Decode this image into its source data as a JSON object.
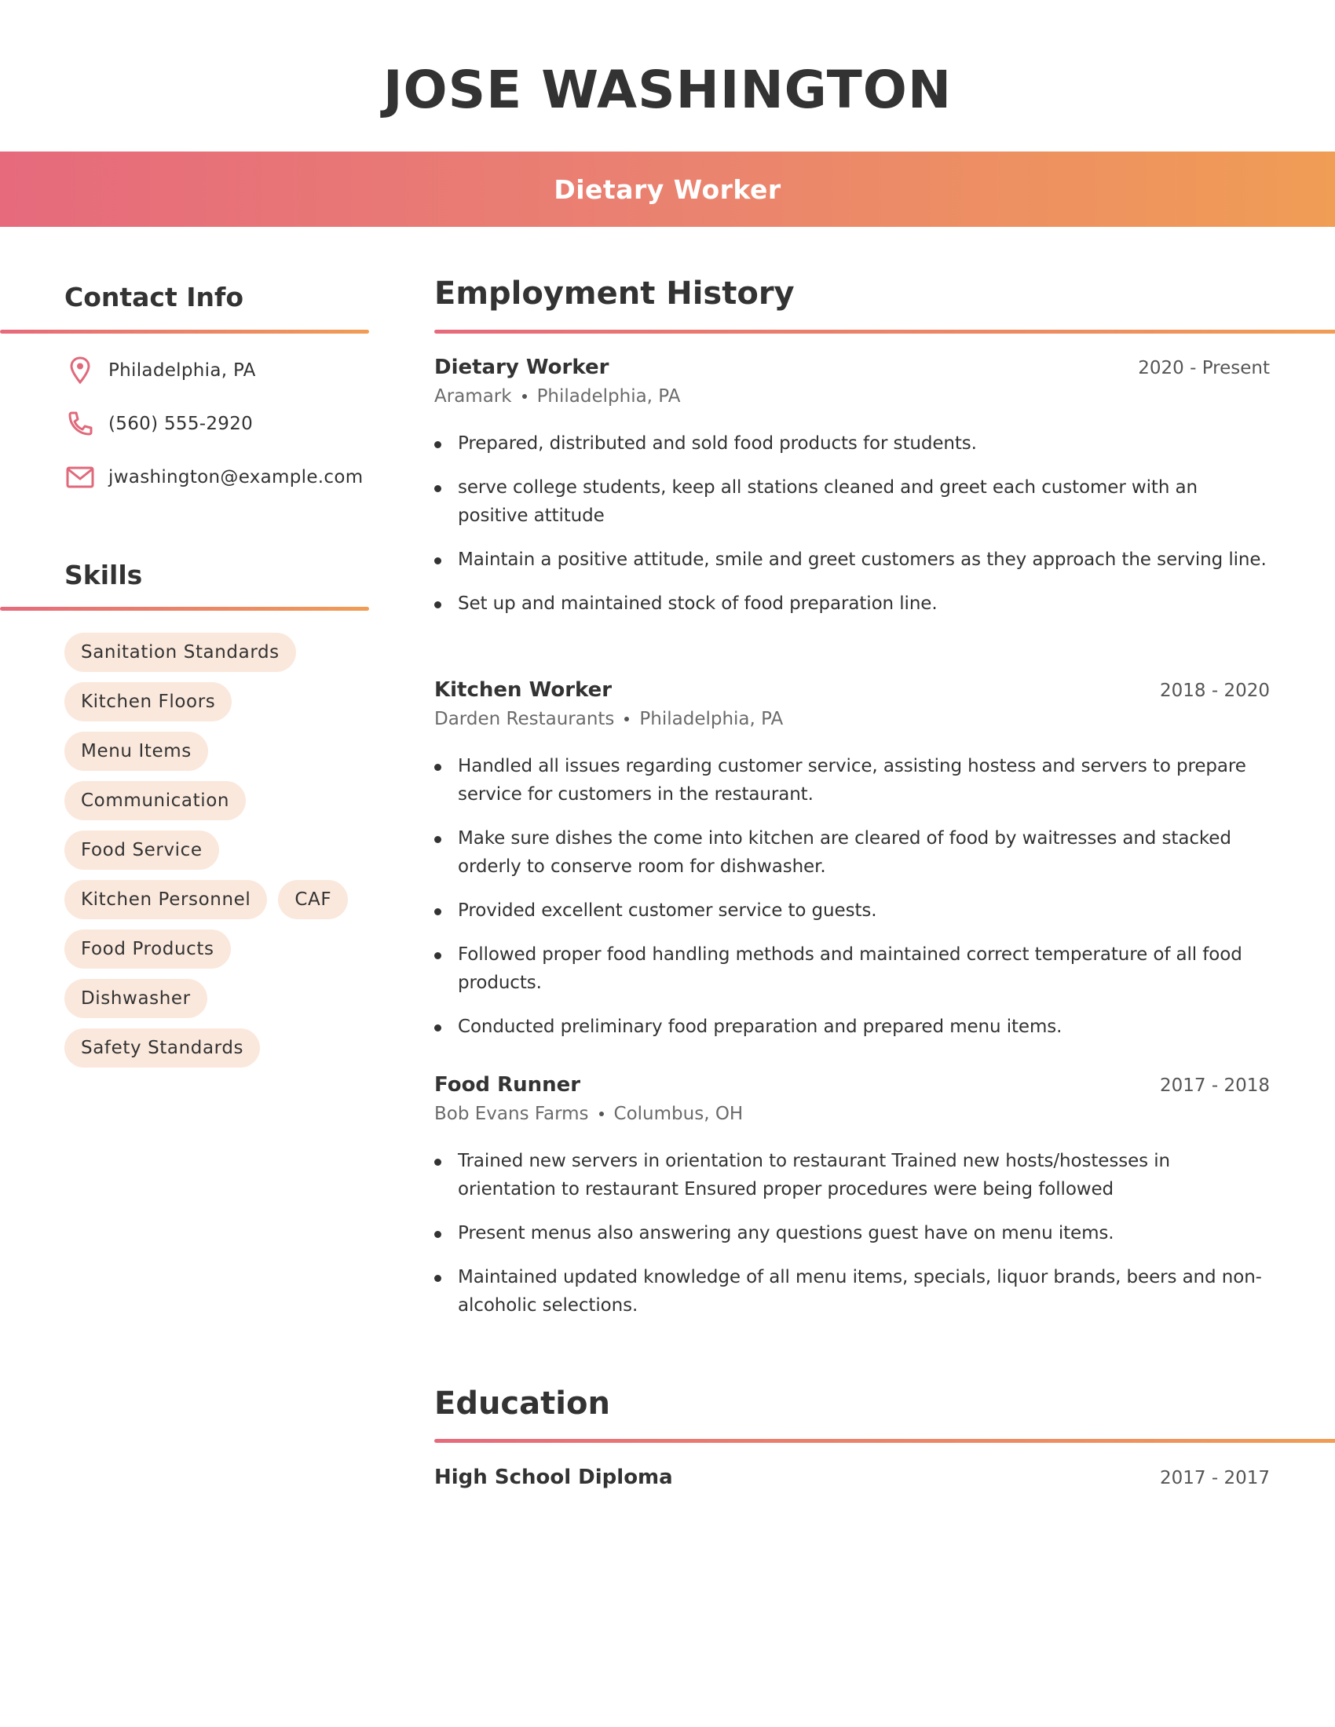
{
  "header": {
    "name": "JOSE WASHINGTON",
    "title": "Dietary Worker"
  },
  "colors": {
    "gradient_start": "#e66a7c",
    "gradient_end": "#f09d55",
    "pill_background": "#fbe8dc",
    "text_primary": "#333333",
    "icon": "#e0697b"
  },
  "contact": {
    "heading": "Contact Info",
    "items": [
      {
        "icon": "location-pin-icon",
        "text": "Philadelphia, PA"
      },
      {
        "icon": "phone-icon",
        "text": "(560) 555-2920"
      },
      {
        "icon": "mail-icon",
        "text": "jwashington@example.com"
      }
    ]
  },
  "skills": {
    "heading": "Skills",
    "rows": [
      [
        "Sanitation Standards"
      ],
      [
        "Kitchen Floors"
      ],
      [
        "Menu Items"
      ],
      [
        "Communication"
      ],
      [
        "Food Service"
      ],
      [
        "Kitchen Personnel",
        "CAF"
      ],
      [
        "Food Products"
      ],
      [
        "Dishwasher"
      ],
      [
        "Safety Standards"
      ]
    ]
  },
  "employment": {
    "heading": "Employment History",
    "jobs": [
      {
        "title": "Dietary Worker",
        "dates": "2020 - Present",
        "company": "Aramark",
        "location": "Philadelphia, PA",
        "bullets": [
          "Prepared, distributed and sold food products for students.",
          "serve college students, keep all stations cleaned and greet each customer with an positive attitude",
          "Maintain a positive attitude, smile and greet customers as they approach the serving line.",
          "Set up and maintained stock of food preparation line."
        ]
      },
      {
        "title": "Kitchen Worker",
        "dates": "2018 - 2020",
        "company": "Darden Restaurants",
        "location": "Philadelphia, PA",
        "bullets": [
          "Handled all issues regarding customer service, assisting hostess and servers to prepare service for customers in the restaurant.",
          "Make sure dishes the come into kitchen are cleared of food by waitresses and stacked orderly to conserve room for dishwasher.",
          "Provided excellent customer service to guests.",
          "Followed proper food handling methods and maintained correct temperature of all food products.",
          "Conducted preliminary food preparation and prepared menu items."
        ]
      },
      {
        "title": "Food Runner",
        "dates": "2017 - 2018",
        "company": "Bob Evans Farms",
        "location": "Columbus, OH",
        "bullets": [
          "Trained new servers in orientation to restaurant Trained new hosts/hostesses in orientation to restaurant Ensured proper procedures were being followed",
          "Present menus also answering any questions guest have on menu items.",
          "Maintained updated knowledge of all menu items, specials, liquor brands, beers and non-alcoholic selections."
        ]
      }
    ]
  },
  "education": {
    "heading": "Education",
    "items": [
      {
        "degree": "High School Diploma",
        "dates": "2017 - 2017"
      }
    ]
  }
}
